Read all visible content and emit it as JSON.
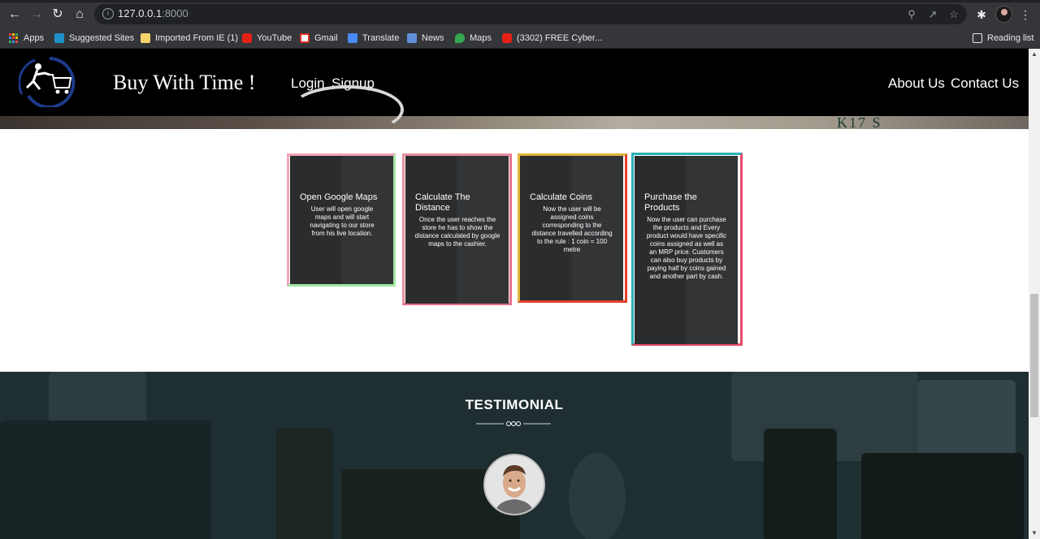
{
  "browser": {
    "url_host": "127.0.0.1",
    "url_port": ":8000",
    "reading_list_label": "Reading list",
    "bookmarks": [
      {
        "label": "Apps",
        "icon": "apps-grid-icon"
      },
      {
        "label": "Suggested Sites",
        "icon": "bing-icon"
      },
      {
        "label": "Imported From IE (1)",
        "icon": "folder-icon"
      },
      {
        "label": "YouTube",
        "icon": "youtube-icon"
      },
      {
        "label": "Gmail",
        "icon": "gmail-icon"
      },
      {
        "label": "Translate",
        "icon": "translate-icon"
      },
      {
        "label": "News",
        "icon": "news-icon"
      },
      {
        "label": "Maps",
        "icon": "maps-icon"
      },
      {
        "label": "(3302) FREE Cyber...",
        "icon": "youtube-icon"
      }
    ]
  },
  "site": {
    "brand": "Buy With Time !",
    "nav_left": [
      "Login",
      "Signup"
    ],
    "nav_right": [
      "About Us",
      "Contact Us"
    ],
    "banner_text": "K17   S"
  },
  "steps": [
    {
      "title": "Open Google Maps",
      "body": "User will open google maps and will start navigating to our store from his live location.",
      "accent": "#f0a8b8"
    },
    {
      "title": "Calculate The Distance",
      "body": "Once the user reaches the store he has to show the distance calculated by google maps to the cashier.",
      "accent": "#e86a78"
    },
    {
      "title": "Calculate Coins",
      "body": "Now the user will be assigned coins corresponding to the distance travelled according to the rule : 1 coin = 100 metre",
      "accent": "#e0b030"
    },
    {
      "title": "Purchase the Products",
      "body": "Now the user can purchase the products and Every product would have specific coins assigned as well as an MRP price. Customers can also buy products by paying half by coins gained and another part by cash.",
      "accent": "#2ab0b0"
    }
  ],
  "testimonial": {
    "title": "TESTIMONIAL"
  }
}
